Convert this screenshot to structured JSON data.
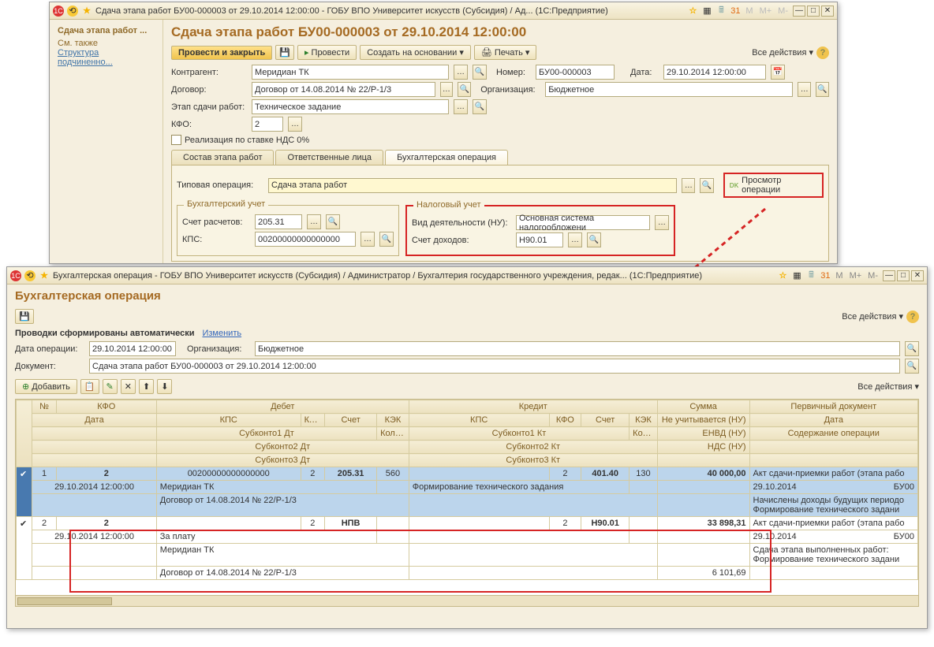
{
  "win1": {
    "title": "Сдача этапа работ БУ00-000003 от 29.10.2014 12:00:00 - ГОБУ ВПО Университет искусств (Субсидия) / Ад...  (1С:Предприятие)",
    "nav_header": "Сдача этапа работ ...",
    "nav_see_also": "См. также",
    "nav_link": "Структура подчиненно...",
    "page_title": "Сдача этапа работ БУ00-000003 от 29.10.2014 12:00:00",
    "btn_post_close": "Провести и закрыть",
    "btn_post": "Провести",
    "btn_create_based": "Создать на основании",
    "btn_print": "Печать",
    "all_actions": "Все действия",
    "lbl_contragent": "Контрагент:",
    "val_contragent": "Меридиан ТК",
    "lbl_number": "Номер:",
    "val_number": "БУ00-000003",
    "lbl_date": "Дата:",
    "val_date": "29.10.2014 12:00:00",
    "lbl_contract": "Договор:",
    "val_contract": "Договор от 14.08.2014 № 22/Р-1/3",
    "lbl_org": "Организация:",
    "val_org": "Бюджетное",
    "lbl_stage": "Этап сдачи работ:",
    "val_stage": "Техническое задание",
    "lbl_kfo": "КФО:",
    "val_kfo": "2",
    "chk_vat0": "Реализация по ставке НДС 0%",
    "tabs": {
      "t1": "Состав этапа работ",
      "t2": "Ответственные лица",
      "t3": "Бухгалтерская операция"
    },
    "lbl_typop": "Типовая операция:",
    "val_typop": "Сдача этапа работ",
    "view_op": "Просмотр операции",
    "grp_acc": "Бухгалтерский учет",
    "lbl_acc_calc": "Счет расчетов:",
    "val_acc_calc": "205.31",
    "lbl_kps": "КПС:",
    "val_kps": "00200000000000000",
    "grp_tax": "Налоговый учет",
    "lbl_activity": "Вид деятельности (НУ):",
    "val_activity": "Основная система налогообложени",
    "lbl_income_acc": "Счет доходов:",
    "val_income_acc": "Н90.01"
  },
  "win2": {
    "title": "Бухгалтерская операция - ГОБУ ВПО Университет искусств (Субсидия) / Администратор / Бухгалтерия государственного учреждения, редак...  (1С:Предприятие)",
    "page_title": "Бухгалтерская операция",
    "all_actions": "Все действия",
    "auto_text": "Проводки сформированы автоматически",
    "change_link": "Изменить",
    "lbl_opdate": "Дата операции:",
    "val_opdate": "29.10.2014 12:00:00",
    "lbl_org": "Организация:",
    "val_org": "Бюджетное",
    "lbl_doc": "Документ:",
    "val_doc": "Сдача этапа работ БУ00-000003 от 29.10.2014 12:00:00",
    "btn_add": "Добавить",
    "hdr": {
      "n": "№",
      "kfo": "КФО",
      "debit": "Дебет",
      "kredit": "Кредит",
      "summa": "Сумма",
      "primary": "Первичный документ",
      "data": "Дата",
      "kps": "КПС",
      "dkfo": "КФО",
      "acct": "Счет",
      "kek": "КЭК",
      "noacct": "Не учитывается (НУ)",
      "content": "Содержание операции",
      "sub1dt": "Субконто1 Дт",
      "qty": "Количество",
      "sub1kt": "Субконто1 Кт",
      "envd": "ЕНВД (НУ)",
      "sub2dt": "Субконто2 Дт",
      "sub2kt": "Субконто2 Кт",
      "nds": "НДС (НУ)",
      "sub3dt": "Субконто3 Дт",
      "sub3kt": "Субконто3 Кт"
    },
    "row1": {
      "n": "1",
      "kfo": "2",
      "date": "29.10.2014 12:00:00",
      "d_kps": "00200000000000000",
      "d_kfo": "2",
      "d_acc": "205.31",
      "d_kek": "560",
      "k_acc": "401.40",
      "k_kfo": "2",
      "k_kek": "130",
      "sum": "40 000,00",
      "doc": "Акт сдачи-приемки работ (этапа рабо",
      "docdate": "29.10.2014",
      "docnum": "БУ00",
      "d_sub1": "Меридиан ТК",
      "k_sub1": "Формирование технического задания",
      "content": "Начислены доходы будущих периодо",
      "content2": "Формирование технического задани",
      "d_sub2": "Договор от 14.08.2014 № 22/Р-1/3"
    },
    "row2": {
      "n": "2",
      "kfo": "2",
      "date": "29.10.2014 12:00:00",
      "d_kfo": "2",
      "d_acc": "НПВ",
      "k_kfo": "2",
      "k_acc": "Н90.01",
      "sum": "33 898,31",
      "doc": "Акт сдачи-приемки работ (этапа рабо",
      "docdate": "29.10.2014",
      "docnum": "БУ00",
      "d_sub1": "За плату",
      "content": "Сдача этапа выполненных работ:",
      "content2": "Формирование технического задани",
      "d_sub2": "Меридиан ТК",
      "d_sub3": "Договор от 14.08.2014 № 22/Р-1/3",
      "nds": "6 101,69"
    }
  }
}
